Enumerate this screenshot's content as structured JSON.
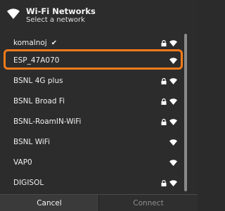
{
  "header": {
    "title": "Wi-Fi Networks",
    "subtitle": "Select a network"
  },
  "networks": [
    {
      "name": "komalnoj",
      "connected": true,
      "locked": true,
      "signal": "wifi-icon"
    },
    {
      "name": "ESP_47A070",
      "connected": false,
      "locked": false,
      "signal": "wifi-icon",
      "highlighted": true
    },
    {
      "name": "BSNL 4G plus",
      "connected": false,
      "locked": true,
      "signal": "wifi-icon"
    },
    {
      "name": "BSNL Broad Fi",
      "connected": false,
      "locked": true,
      "signal": "wifi-icon"
    },
    {
      "name": "BSNL-RoamIN-WiFi",
      "connected": false,
      "locked": true,
      "signal": "wifi-icon"
    },
    {
      "name": "BSNL WiFi",
      "connected": false,
      "locked": false,
      "signal": "wifi-icon"
    },
    {
      "name": "VAP0",
      "connected": false,
      "locked": false,
      "signal": "wifi-icon"
    },
    {
      "name": "DIGISOL",
      "connected": false,
      "locked": true,
      "signal": "wifi-icon"
    }
  ],
  "buttons": {
    "cancel": "Cancel",
    "connect": "Connect"
  },
  "colors": {
    "highlight": "#f07a1a",
    "background": "#2c2c2c",
    "text": "#f0f0f0",
    "disabled_text": "#8e8e8e"
  }
}
